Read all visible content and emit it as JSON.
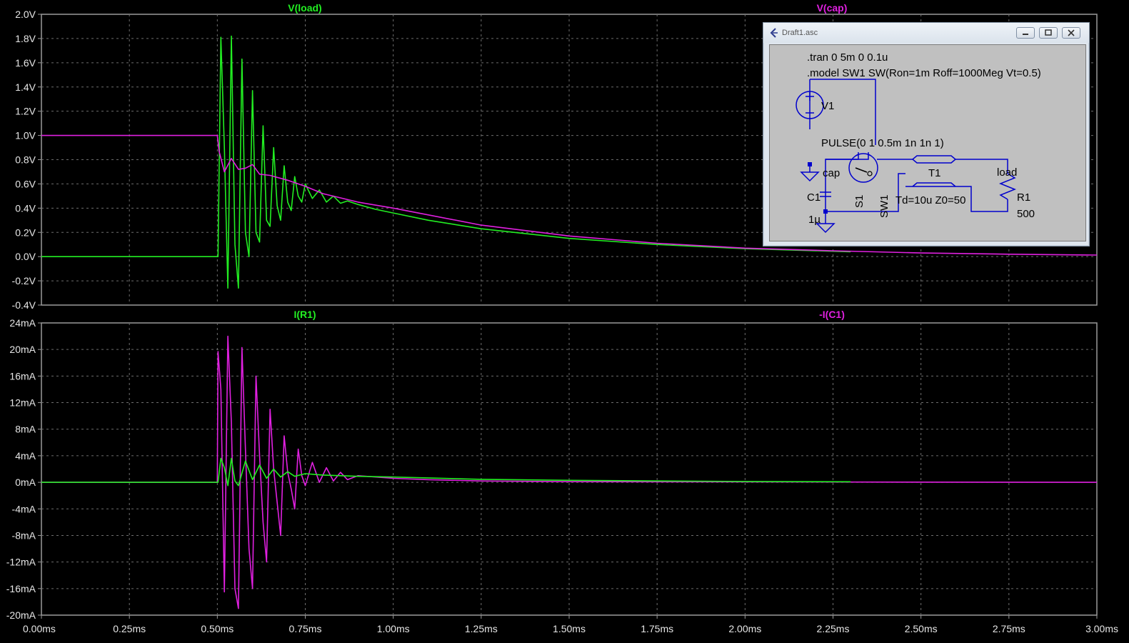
{
  "window": {
    "title": "Draft1.asc"
  },
  "colors": {
    "green": "#22ee22",
    "magenta": "#e020e0",
    "grid": "#6e6e6e",
    "axis": "#9a9a9a",
    "wire": "#0000cc"
  },
  "icons": {
    "app": "ltspice-icon",
    "minimize": "minimize-icon",
    "maximize": "maximize-icon",
    "close": "close-icon"
  },
  "chart_data": [
    {
      "type": "line",
      "xlim": [
        0,
        3.0
      ],
      "ylim": [
        -0.4,
        2.0
      ],
      "x_ticks": [
        "0.00ms",
        "0.25ms",
        "0.50ms",
        "0.75ms",
        "1.00ms",
        "1.25ms",
        "1.50ms",
        "1.75ms",
        "2.00ms",
        "2.25ms",
        "2.50ms",
        "2.75ms",
        "3.00ms"
      ],
      "y_ticks": [
        "2.0V",
        "1.8V",
        "1.6V",
        "1.4V",
        "1.2V",
        "1.0V",
        "0.8V",
        "0.6V",
        "0.4V",
        "0.2V",
        "0.0V",
        "-0.2V",
        "-0.4V"
      ],
      "series": [
        {
          "name": "V(load)",
          "color": "#22ee22",
          "x": [
            0,
            0.5,
            0.502,
            0.51,
            0.52,
            0.53,
            0.54,
            0.55,
            0.56,
            0.57,
            0.58,
            0.59,
            0.6,
            0.61,
            0.62,
            0.63,
            0.64,
            0.65,
            0.66,
            0.67,
            0.68,
            0.69,
            0.7,
            0.71,
            0.72,
            0.73,
            0.74,
            0.75,
            0.77,
            0.79,
            0.81,
            0.83,
            0.85,
            0.87,
            0.9,
            0.95,
            1.0,
            1.1,
            1.25,
            1.5,
            1.75,
            2.0,
            2.3
          ],
          "y": [
            0,
            0,
            0,
            1.81,
            0.9,
            -0.26,
            1.82,
            0.1,
            -0.26,
            1.63,
            0.2,
            0.0,
            1.37,
            0.2,
            0.12,
            1.08,
            0.3,
            0.25,
            0.9,
            0.42,
            0.3,
            0.75,
            0.45,
            0.38,
            0.66,
            0.5,
            0.45,
            0.6,
            0.48,
            0.55,
            0.45,
            0.5,
            0.44,
            0.46,
            0.43,
            0.39,
            0.36,
            0.3,
            0.23,
            0.15,
            0.1,
            0.065,
            0.04
          ]
        },
        {
          "name": "V(cap)",
          "color": "#e020e0",
          "x": [
            0,
            0.5,
            0.505,
            0.52,
            0.54,
            0.56,
            0.58,
            0.6,
            0.62,
            0.65,
            0.7,
            0.75,
            0.8,
            0.9,
            1.0,
            1.25,
            1.5,
            1.75,
            2.0,
            2.25,
            2.5,
            2.75,
            3.0
          ],
          "y": [
            1.0,
            1.0,
            0.87,
            0.7,
            0.81,
            0.72,
            0.73,
            0.76,
            0.68,
            0.67,
            0.63,
            0.58,
            0.52,
            0.45,
            0.4,
            0.26,
            0.17,
            0.11,
            0.07,
            0.048,
            0.03,
            0.02,
            0.013
          ]
        }
      ]
    },
    {
      "type": "line",
      "xlim": [
        0,
        3.0
      ],
      "ylim": [
        -20,
        24
      ],
      "x_ticks": [
        "0.00ms",
        "0.25ms",
        "0.50ms",
        "0.75ms",
        "1.00ms",
        "1.25ms",
        "1.50ms",
        "1.75ms",
        "2.00ms",
        "2.25ms",
        "2.50ms",
        "2.75ms",
        "3.00ms"
      ],
      "y_ticks": [
        "24mA",
        "20mA",
        "16mA",
        "12mA",
        "8mA",
        "4mA",
        "0mA",
        "-4mA",
        "-8mA",
        "-12mA",
        "-16mA",
        "-20mA"
      ],
      "series": [
        {
          "name": "-I(C1)",
          "color": "#e020e0",
          "x": [
            0,
            0.5,
            0.502,
            0.51,
            0.52,
            0.53,
            0.54,
            0.55,
            0.56,
            0.57,
            0.58,
            0.59,
            0.6,
            0.61,
            0.62,
            0.63,
            0.64,
            0.65,
            0.66,
            0.67,
            0.68,
            0.69,
            0.7,
            0.71,
            0.72,
            0.73,
            0.74,
            0.75,
            0.77,
            0.79,
            0.81,
            0.83,
            0.85,
            0.87,
            0.9,
            1.0,
            1.1,
            1.25,
            1.5,
            3.0
          ],
          "y": [
            0,
            0,
            19.7,
            14,
            -16.5,
            22,
            9,
            -16,
            -19,
            20.3,
            5,
            -10,
            -16,
            16,
            4,
            -6,
            -12,
            11,
            2,
            -3,
            -8,
            7,
            1.5,
            -1,
            -4,
            5,
            1,
            -0.5,
            3,
            0,
            2.2,
            0.2,
            1.5,
            0.4,
            1,
            0.6,
            0.4,
            0.2,
            0.1,
            0
          ]
        },
        {
          "name": "I(R1)",
          "color": "#22ee22",
          "x": [
            0,
            0.5,
            0.502,
            0.51,
            0.52,
            0.53,
            0.54,
            0.55,
            0.56,
            0.58,
            0.6,
            0.62,
            0.64,
            0.66,
            0.68,
            0.7,
            0.72,
            0.75,
            0.8,
            0.9,
            1.0,
            1.25,
            1.5,
            1.75,
            2.0,
            2.3
          ],
          "y": [
            0,
            0,
            0,
            3.6,
            2.2,
            -0.5,
            3.6,
            0.2,
            -0.5,
            3.2,
            0.4,
            2.6,
            0.6,
            2.0,
            0.8,
            1.6,
            0.9,
            1.3,
            1.1,
            0.9,
            0.8,
            0.45,
            0.3,
            0.2,
            0.13,
            0.08
          ]
        }
      ]
    }
  ],
  "schematic": {
    "directive_tran": ".tran 0 5m 0 0.1u",
    "directive_model": ".model SW1 SW(Ron=1m Roff=1000Meg Vt=0.5)",
    "v1_name": "V1",
    "v1_value": "PULSE(0 1 0.5m 1n 1n 1)",
    "c1_name": "C1",
    "c1_value": "1µ",
    "s1_name": "S1",
    "s1_model": "SW1",
    "t1_name": "T1",
    "t1_value": "Td=10u Z0=50",
    "r1_name": "R1",
    "r1_value": "500",
    "net_cap": "cap",
    "net_load": "load"
  }
}
